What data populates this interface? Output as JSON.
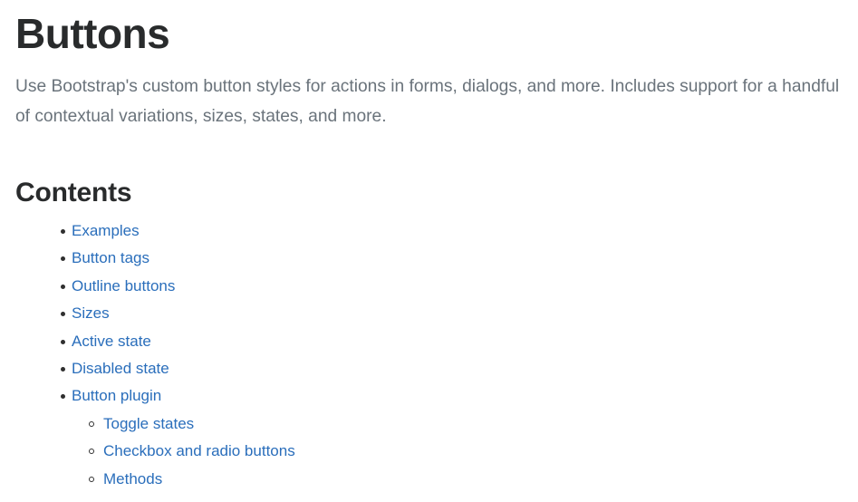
{
  "page": {
    "title": "Buttons",
    "lead": "Use Bootstrap's custom button styles for actions in forms, dialogs, and more. Includes support for a handful of contextual variations, sizes, states, and more.",
    "contents_heading": "Contents"
  },
  "colors": {
    "link": "#2a6ebb",
    "heading": "#292b2c",
    "lead_text": "#6a737b",
    "background": "#ffffff",
    "bullet": "#2f2f2f"
  },
  "contents": [
    {
      "label": "Examples",
      "children": []
    },
    {
      "label": "Button tags",
      "children": []
    },
    {
      "label": "Outline buttons",
      "children": []
    },
    {
      "label": "Sizes",
      "children": []
    },
    {
      "label": "Active state",
      "children": []
    },
    {
      "label": "Disabled state",
      "children": []
    },
    {
      "label": "Button plugin",
      "children": [
        {
          "label": "Toggle states"
        },
        {
          "label": "Checkbox and radio buttons"
        },
        {
          "label": "Methods"
        }
      ]
    }
  ]
}
